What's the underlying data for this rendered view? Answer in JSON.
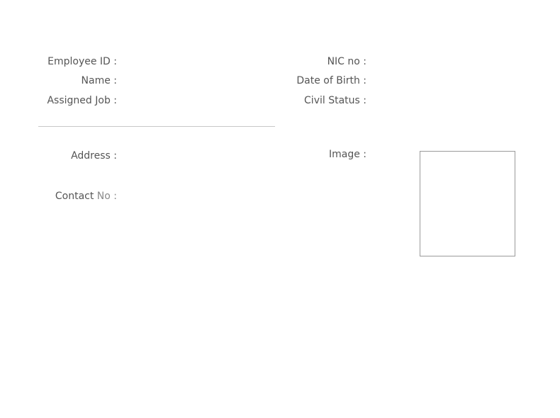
{
  "form": {
    "left": {
      "employee_id_label": "Employee ID :",
      "name_label": "Name :",
      "assigned_job_label": "Assigned Job :",
      "address_label": "Address :",
      "contact_label_main": "Contact ",
      "contact_label_suffix": "No :"
    },
    "right": {
      "nic_label": "NIC no :",
      "dob_label": "Date of Birth :",
      "civil_status_label": "Civil Status :",
      "image_label": "Image :"
    }
  }
}
